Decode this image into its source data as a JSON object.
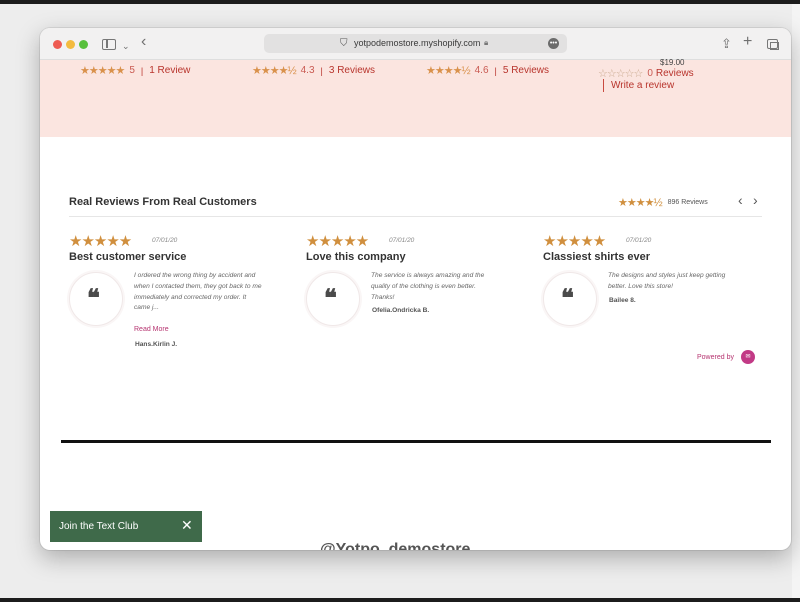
{
  "browser": {
    "url": "yotpodemostore.myshopify.com"
  },
  "product_stats": [
    {
      "stars": "★★★★★",
      "rating": "5",
      "count": "1 Review"
    },
    {
      "stars": "★★★★½",
      "rating": "4.3",
      "count": "3 Reviews"
    },
    {
      "stars": "★★★★½",
      "rating": "4.6",
      "count": "5 Reviews"
    },
    {
      "stars": "☆☆☆☆☆",
      "rating": "0",
      "count": "Reviews"
    }
  ],
  "product4": {
    "price": "$19.00",
    "write_review": "Write a review"
  },
  "reviews_section": {
    "title": "Real Reviews From Real Customers",
    "summary_stars": "★★★★½",
    "summary_count": "896 Reviews"
  },
  "reviews": [
    {
      "stars": "★★★★★",
      "date": "07/01/20",
      "title": "Best customer service",
      "body": "I ordered the wrong thing by accident and when I contacted them, they got back to me immediately and corrected my order. It came j...",
      "read_more": "Read More",
      "author": "Hans.Kirlin J."
    },
    {
      "stars": "★★★★★",
      "date": "07/01/20",
      "title": "Love this company",
      "body": "The service is always amazing and the quality of the clothing is even better. Thanks!",
      "author": "Ofelia.Ondricka B."
    },
    {
      "stars": "★★★★★",
      "date": "07/01/20",
      "title": "Classiest shirts ever",
      "body": "The designs and styles just keep getting better. Love this store!",
      "author": "Bailee 8."
    }
  ],
  "powered_by": "Powered by",
  "text_club": {
    "label": "Join the Text Club",
    "close": "✕"
  },
  "instagram_handle": "@Yotpo_demostore",
  "colors": {
    "accent": "#b8342c",
    "star": "#d08f3e",
    "pink_band": "#fbe5e0",
    "text_club_bg": "#3f6a4a",
    "brand_magenta": "#b63470"
  }
}
